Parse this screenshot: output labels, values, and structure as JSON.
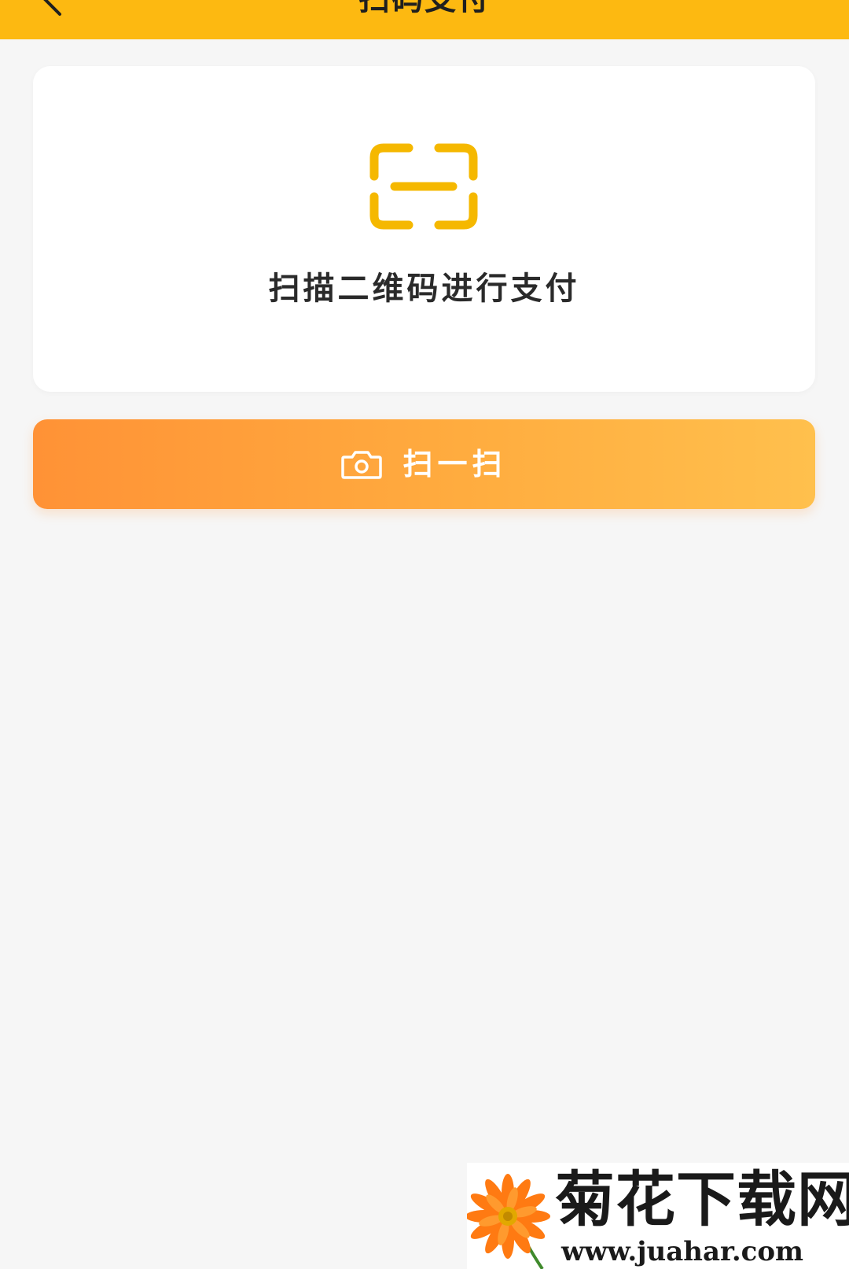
{
  "header": {
    "title": "扫码支付",
    "back_icon": "chevron-left-icon",
    "background_color": "#fdb911"
  },
  "scan_card": {
    "icon": "scan-frame-icon",
    "icon_color": "#f5b800",
    "prompt": "扫描二维码进行支付"
  },
  "scan_button": {
    "icon": "camera-icon",
    "label": "扫一扫",
    "gradient_start": "#ff9236",
    "gradient_end": "#ffc04d"
  },
  "watermark": {
    "logo": "flower-icon",
    "name": "菊花下载网",
    "url": "www.juahar.com"
  }
}
